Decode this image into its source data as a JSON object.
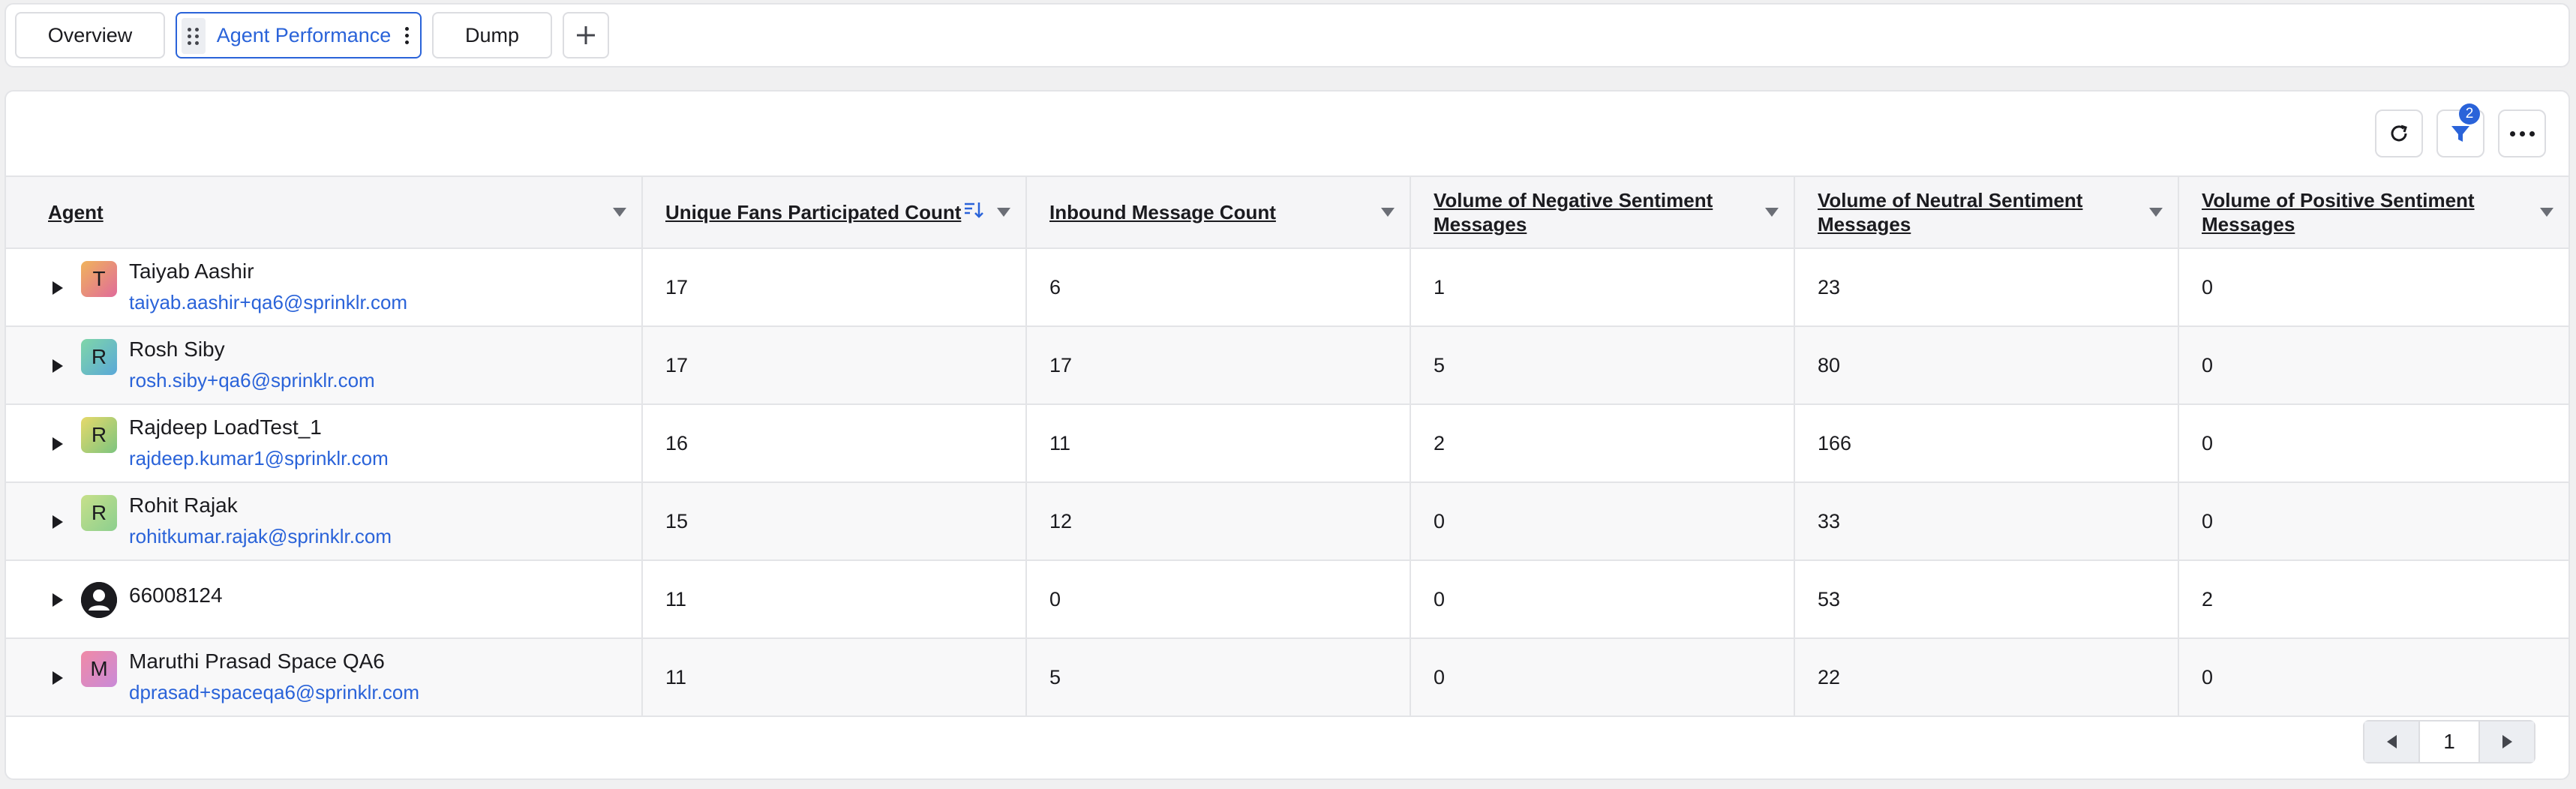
{
  "tabs": [
    {
      "label": "Overview"
    },
    {
      "label": "Agent Performance"
    },
    {
      "label": "Dump"
    }
  ],
  "toolbar": {
    "filter_badge": "2",
    "refresh_icon": "refresh-icon",
    "filter_icon": "filter-icon",
    "more_icon": "more-horizontal-icon"
  },
  "table": {
    "columns": [
      {
        "label": "Agent"
      },
      {
        "label": "Unique Fans Participated Count"
      },
      {
        "label": "Inbound Message Count"
      },
      {
        "label": "Volume of Negative Sentiment Messages"
      },
      {
        "label": "Volume of Neutral Sentiment Messages"
      },
      {
        "label": "Volume of Positive Sentiment Messages"
      }
    ],
    "rows": [
      {
        "initial": "T",
        "name": "Taiyab Aashir",
        "email": "taiyab.aashir+qa6@sprinklr.com",
        "fans": "17",
        "inbound": "6",
        "negative": "1",
        "neutral": "23",
        "positive": "0",
        "avatar_color": "#e9887a"
      },
      {
        "initial": "R",
        "name": "Rosh Siby",
        "email": "rosh.siby+qa6@sprinklr.com",
        "fans": "17",
        "inbound": "17",
        "negative": "5",
        "neutral": "80",
        "positive": "0",
        "avatar_color": "#6cc4b8"
      },
      {
        "initial": "R",
        "name": "Rajdeep LoadTest_1",
        "email": "rajdeep.kumar1@sprinklr.com",
        "fans": "16",
        "inbound": "11",
        "negative": "2",
        "neutral": "166",
        "positive": "0",
        "avatar_color": "#b5cf72"
      },
      {
        "initial": "R",
        "name": "Rohit Rajak",
        "email": "rohitkumar.rajak@sprinklr.com",
        "fans": "15",
        "inbound": "12",
        "negative": "0",
        "neutral": "33",
        "positive": "0",
        "avatar_color": "#a6d48c"
      },
      {
        "initial": "",
        "name": "66008124",
        "email": "",
        "fans": "11",
        "inbound": "0",
        "negative": "0",
        "neutral": "53",
        "positive": "2",
        "avatar_color": "#1b1b1f"
      },
      {
        "initial": "M",
        "name": "Maruthi Prasad Space QA6",
        "email": "dprasad+spaceqa6@sprinklr.com",
        "fans": "11",
        "inbound": "5",
        "negative": "0",
        "neutral": "22",
        "positive": "0",
        "avatar_color": "#e389b8"
      }
    ]
  },
  "pager": {
    "page": "1"
  }
}
